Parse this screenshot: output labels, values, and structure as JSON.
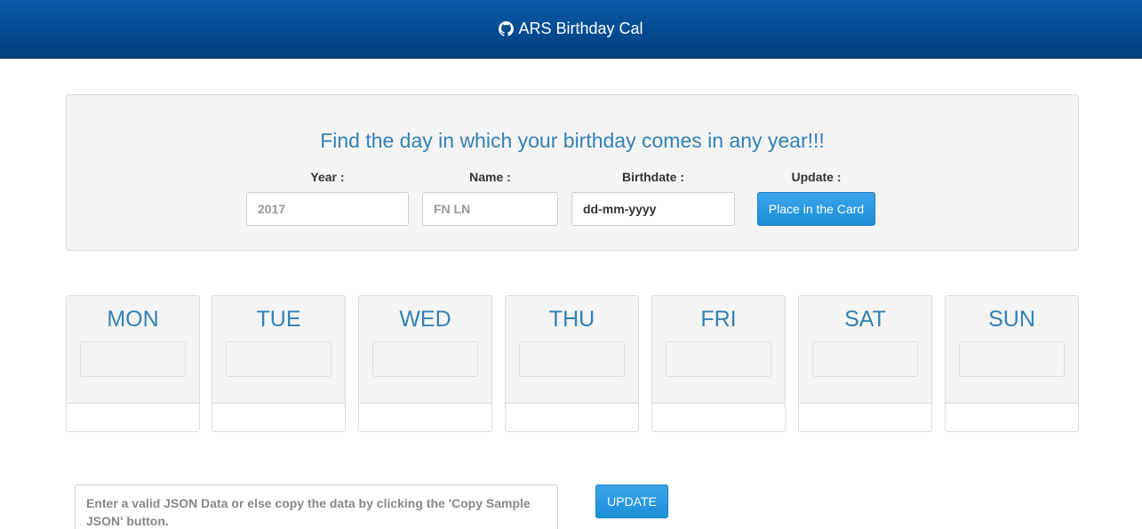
{
  "header": {
    "title": "ARS Birthday Cal",
    "icon": "github-icon"
  },
  "form": {
    "heading": "Find the day in which your birthday comes in any year!!!",
    "year_label": "Year :",
    "year_placeholder": "2017",
    "name_label": "Name :",
    "name_placeholder": "FN LN",
    "birthdate_label": "Birthdate :",
    "birthdate_value": "dd-mm-yyyy",
    "update_label": "Update :",
    "place_button": "Place in the Card"
  },
  "days": [
    "MON",
    "TUE",
    "WED",
    "THU",
    "FRI",
    "SAT",
    "SUN"
  ],
  "json_section": {
    "placeholder": "Enter a valid JSON Data or else copy the data by clicking the 'Copy Sample JSON' button.",
    "update_button": "UPDATE"
  },
  "colors": {
    "navbar": "#044a8f",
    "accent": "#3281b5",
    "button": "#2a9be3"
  }
}
